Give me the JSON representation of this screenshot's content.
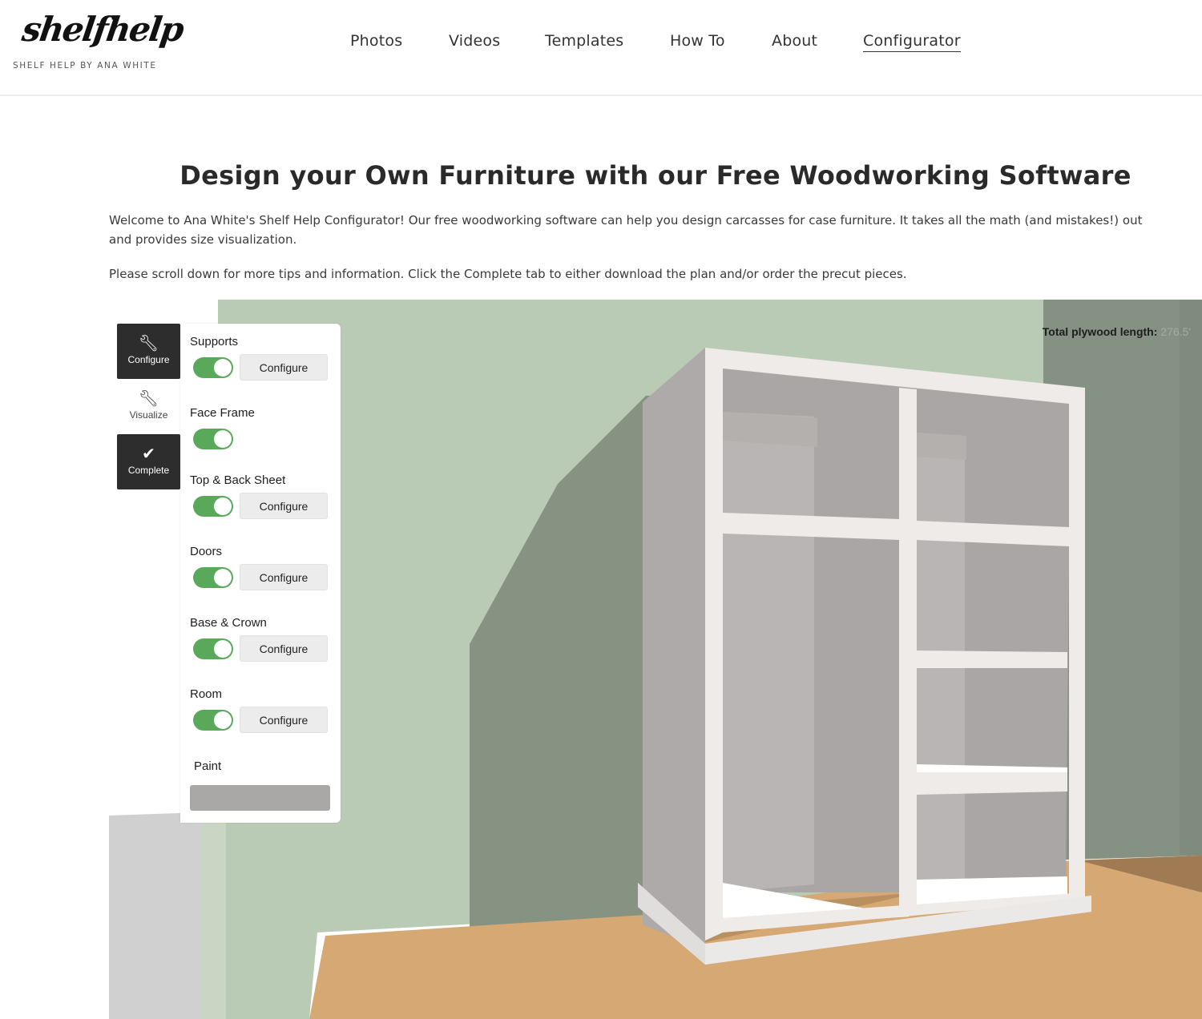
{
  "header": {
    "logo_script": "shelfhelp",
    "logo_subtitle": "SHELF HELP BY ANA WHITE",
    "nav": [
      {
        "label": "Photos",
        "active": false
      },
      {
        "label": "Videos",
        "active": false
      },
      {
        "label": "Templates",
        "active": false
      },
      {
        "label": "How To",
        "active": false
      },
      {
        "label": "About",
        "active": false
      },
      {
        "label": "Configurator",
        "active": true
      }
    ]
  },
  "intro": {
    "title": "Design your Own Furniture with our Free Woodworking Software",
    "paragraph1_line1": "Welcome to Ana White's Shelf Help Configurator! Our free woodworking software can help you design carcasses for case furniture. It takes all the math (and mistakes!) out",
    "paragraph1_line2": "and provides size visualization.",
    "paragraph2": "Please scroll down for more tips and information. Click the Complete tab to either download the plan and/or order the precut pieces."
  },
  "configurator": {
    "plywood_label": "Total plywood length:",
    "plywood_value": "276.5'",
    "side_tabs": [
      {
        "label": "Configure",
        "icon": "wrench-icon",
        "active": false
      },
      {
        "label": "Visualize",
        "icon": "wrench-icon",
        "active": true
      },
      {
        "label": "Complete",
        "icon": "checkmark-icon",
        "active": false
      }
    ],
    "sections": [
      {
        "label": "Supports",
        "enabled": true,
        "button": "Configure"
      },
      {
        "label": "Face Frame",
        "enabled": true,
        "button": null
      },
      {
        "label": "Top & Back Sheet",
        "enabled": true,
        "button": "Configure"
      },
      {
        "label": "Doors",
        "enabled": true,
        "button": "Configure"
      },
      {
        "label": "Base & Crown",
        "enabled": true,
        "button": "Configure"
      },
      {
        "label": "Room",
        "enabled": true,
        "button": "Configure"
      }
    ],
    "paint_label": "Paint",
    "colors": {
      "toggle_on": "#5aa85a",
      "paint_swatch": "#aaa7a7",
      "wall_light": "#b9cab5",
      "wall_dark": "#859283",
      "floor": "#d6a874",
      "cabinet_white": "#eeebe9"
    }
  }
}
